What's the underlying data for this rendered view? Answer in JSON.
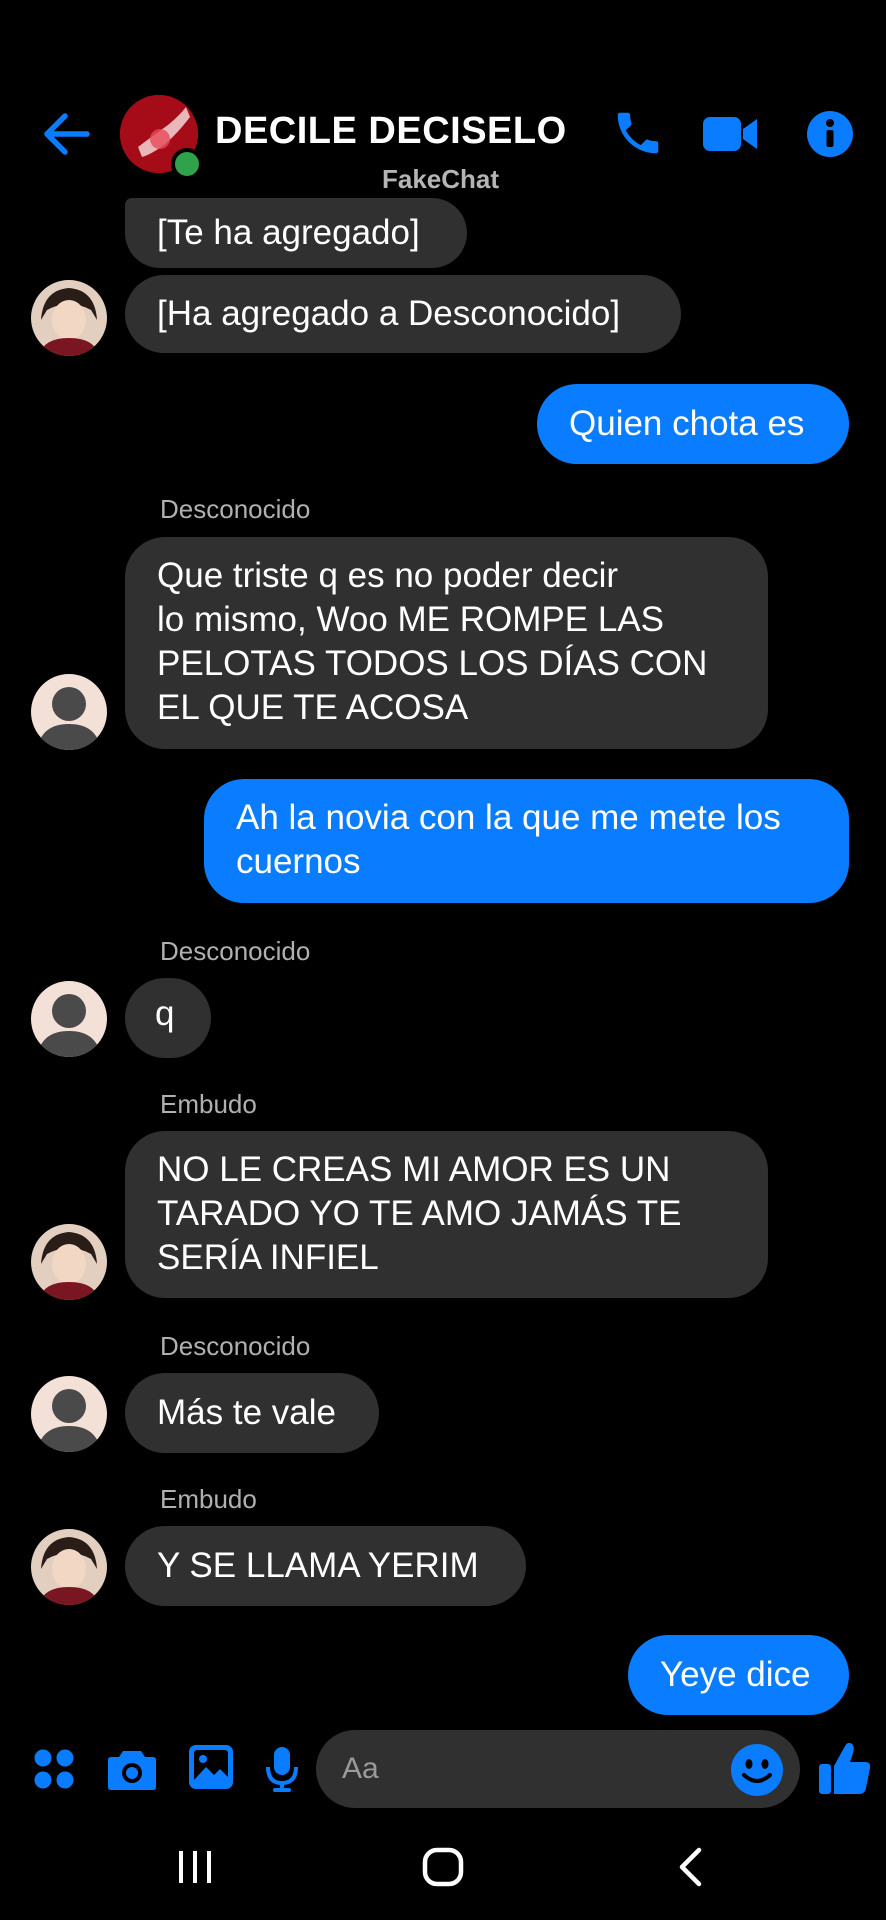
{
  "header": {
    "title": "DECILE DECISELO",
    "watermark": "FakeChat",
    "icons": [
      "back-arrow-icon",
      "phone-icon",
      "video-camera-icon",
      "info-icon"
    ]
  },
  "messages": [
    {
      "id": 1,
      "side": "in",
      "sender": "",
      "text": "[Te ha agregado]",
      "avatar": "none"
    },
    {
      "id": 2,
      "side": "in",
      "sender": "",
      "text": "[Ha agregado a Desconocido]",
      "avatar": "photo"
    },
    {
      "id": 3,
      "side": "out",
      "text": "Quien chota es"
    },
    {
      "id": 4,
      "side": "in",
      "sender": "Desconocido",
      "text": "Que triste q es no poder decir\nlo mismo, Woo ME ROMPE LAS\nPELOTAS TODOS LOS DÍAS CON\nEL QUE TE ACOSA",
      "avatar": "default"
    },
    {
      "id": 5,
      "side": "out",
      "text": "Ah la novia con la que me mete los\ncuernos"
    },
    {
      "id": 6,
      "side": "in",
      "sender": "Desconocido",
      "text": "q",
      "avatar": "default"
    },
    {
      "id": 7,
      "side": "in",
      "sender": "Embudo",
      "text": "NO LE CREAS MI AMOR ES UN\nTARADO YO TE AMO JAMÁS TE\nSERÍA INFIEL",
      "avatar": "photo"
    },
    {
      "id": 8,
      "side": "in",
      "sender": "Desconocido",
      "text": "Más te vale",
      "avatar": "default"
    },
    {
      "id": 9,
      "side": "in",
      "sender": "Embudo",
      "text": "Y SE LLAMA YERIM",
      "avatar": "photo"
    },
    {
      "id": 10,
      "side": "out",
      "text": "Yeye dice"
    }
  ],
  "composer": {
    "placeholder": "Aa",
    "icons": [
      "apps-grid-icon",
      "camera-icon",
      "image-icon",
      "microphone-icon",
      "emoji-icon",
      "thumbs-up-icon"
    ]
  },
  "navbar": {
    "icons": [
      "recent-apps-icon",
      "home-icon",
      "back-icon"
    ]
  },
  "colors": {
    "accent": "#0a7cff",
    "background": "#000000",
    "incoming_bubble": "#303030",
    "online": "#31a24c"
  }
}
